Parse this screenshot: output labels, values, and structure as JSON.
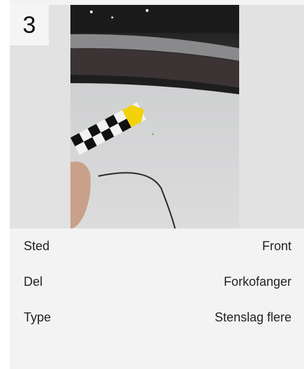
{
  "damage": {
    "number": "3",
    "photo_description_icon": "photo-icon",
    "fields": [
      {
        "label": "Sted",
        "value": "Front"
      },
      {
        "label": "Del",
        "value": "Forkofanger"
      },
      {
        "label": "Type",
        "value": "Stenslag flere"
      }
    ]
  }
}
